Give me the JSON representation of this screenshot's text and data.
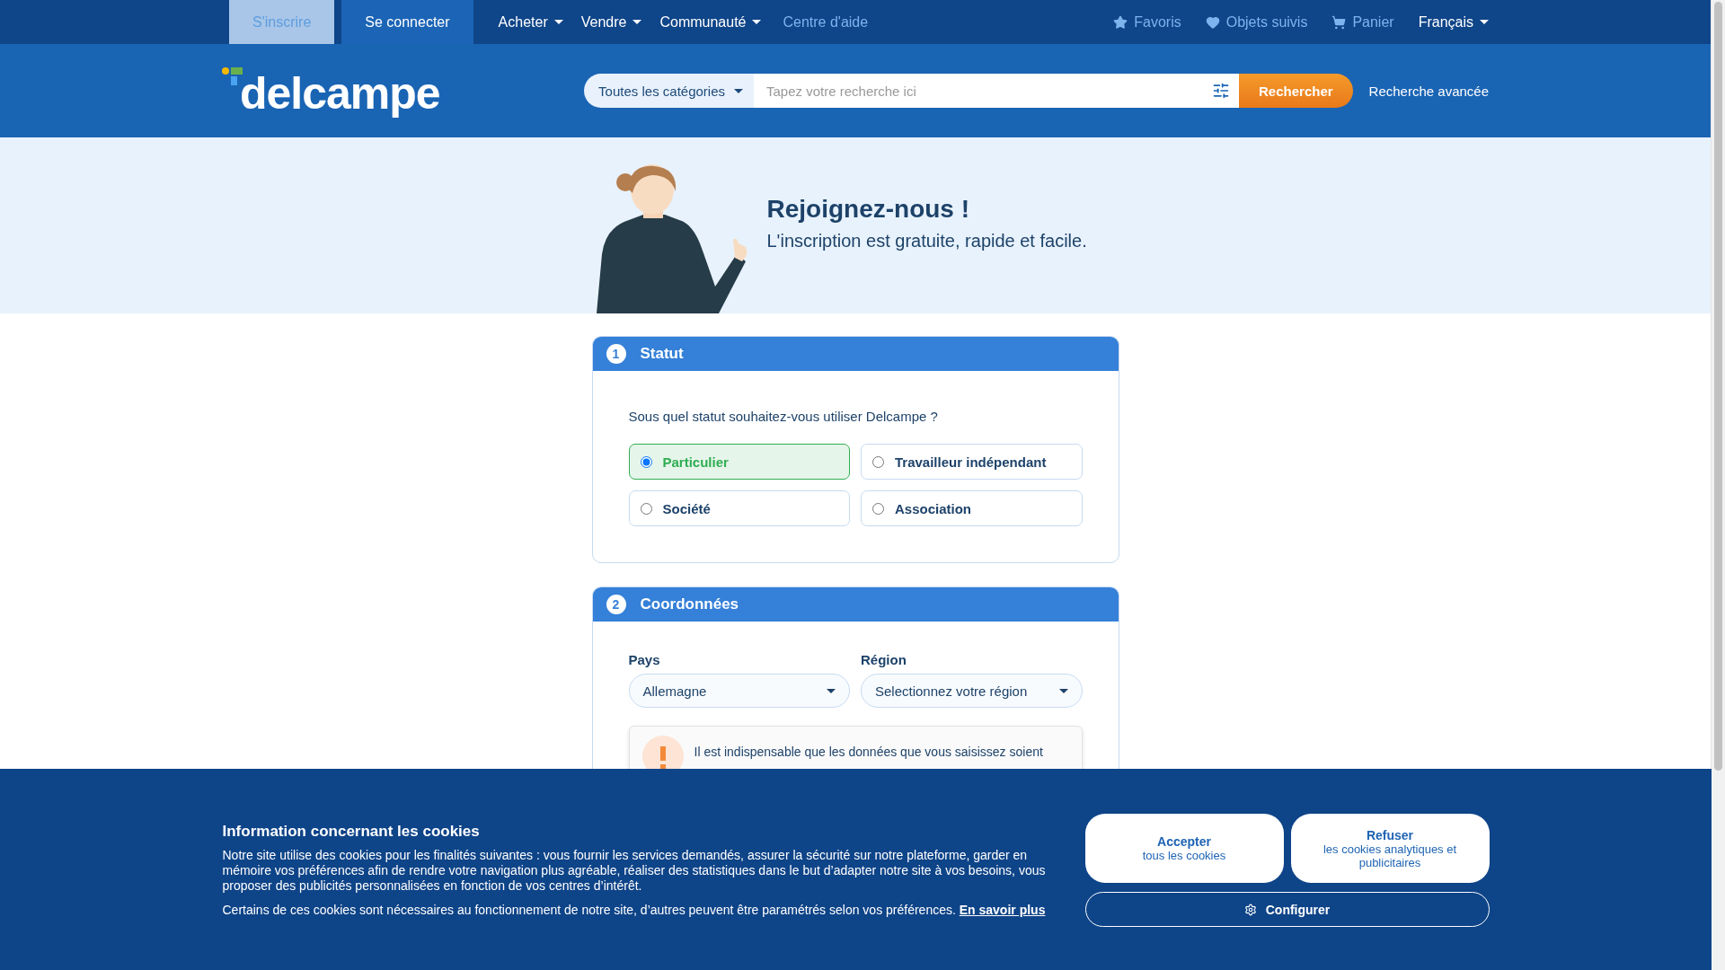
{
  "top_nav": {
    "account_tabs": [
      {
        "label": "S'inscrire",
        "selected": true
      },
      {
        "label": "Se connecter",
        "selected": false
      }
    ],
    "menus": [
      {
        "label": "Acheter",
        "kind": "dropdown"
      },
      {
        "label": "Vendre",
        "kind": "dropdown"
      },
      {
        "label": "Communauté",
        "kind": "dropdown"
      },
      {
        "label": "Centre d'aide",
        "kind": "link"
      }
    ],
    "user_links": [
      {
        "label": "Favoris"
      },
      {
        "label": "Objets suivis"
      },
      {
        "label": "Panier"
      }
    ],
    "language": "Français"
  },
  "header": {
    "logo": "delcampe",
    "category_select": "Toutes les catégories",
    "search": {
      "placeholder": "Tapez votre recherche ici"
    },
    "search_button": "Rechercher",
    "advanced_link": "Recherche avancée"
  },
  "hero": {
    "title": "Rejoignez-nous !",
    "subtitle": "L'inscription est gratuite, rapide et facile."
  },
  "status_section": {
    "number": "1",
    "title": "Statut",
    "question": "Sous quel statut souhaitez-vous utiliser Delcampe ?",
    "options": [
      {
        "label": "Particulier",
        "selected": true
      },
      {
        "label": "Travailleur indépendant",
        "selected": false
      },
      {
        "label": "Société",
        "selected": false
      },
      {
        "label": "Association",
        "selected": false
      }
    ]
  },
  "contact_section": {
    "number": "2",
    "title": "Coordonnées",
    "fields": [
      {
        "label": "Pays",
        "value": "Allemagne"
      },
      {
        "label": "Région",
        "value": "Selectionnez votre région"
      }
    ],
    "notice": "Il est indispensable que les données que vous saisissez soient"
  },
  "cookie_banner": {
    "title": "Information concernant les cookies",
    "paragraphs": [
      "Notre site utilise des cookies pour les finalités suivantes : vous fournir les services demandés, assurer la sécurité sur notre plateforme, garder en mémoire vos préférences afin de rendre votre navigation plus agréable, réaliser des statistiques dans le but d’adapter notre site à vos besoins, vous proposer des publicités personnalisées en fonction de vos centres d’intérêt.",
      "Certains de ces cookies sont nécessaires au fonctionnement de notre site, d’autres peuvent être paramétrés selon vos préférences."
    ],
    "link": "En savoir plus",
    "buttons": [
      {
        "title": "Accepter",
        "subtitle": "tous les cookies"
      },
      {
        "title": "Refuser",
        "subtitle": "les cookies analytiques et publicitaires"
      }
    ],
    "configure": "Configurer"
  }
}
